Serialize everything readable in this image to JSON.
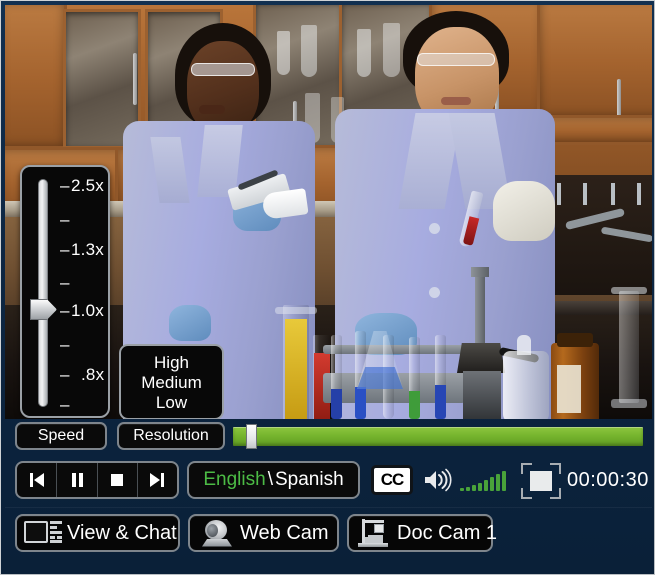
{
  "app": {
    "title": "Video Player — Chemistry Lab Session",
    "panel_color": "#0d2744",
    "accent_green": "#8dc63f",
    "language_active_color": "#4cbb45"
  },
  "video": {
    "scene_description": "Two students in lavender lab coats and safety goggles working at a chemistry bench with graduated cylinders, test tube rack, bunsen burner, amber reagent bottle and wash bottle; wooden glass-front cabinets behind.",
    "alt": "Chemistry laboratory video frame"
  },
  "speed_overlay": {
    "name": "Speed",
    "selected_value": "1.0x",
    "ticks": [
      {
        "label": "2.5x",
        "major": true
      },
      {
        "label": "",
        "major": false
      },
      {
        "label": "1.3x",
        "major": true
      },
      {
        "label": "",
        "major": false
      },
      {
        "label": "1.0x",
        "major": true
      },
      {
        "label": "",
        "major": false
      },
      {
        "label": ".8x",
        "major": true
      },
      {
        "label": "",
        "major": false
      }
    ]
  },
  "resolution_menu": {
    "options": [
      "High",
      "Medium",
      "Low"
    ]
  },
  "toolbar": {
    "speed_label": "Speed",
    "resolution_label": "Resolution",
    "progress": {
      "value_percent": 3,
      "buffered_percent": 100
    }
  },
  "transport": {
    "buttons": [
      {
        "name": "previous",
        "icon": "skip-back-icon",
        "label": "Previous"
      },
      {
        "name": "pause",
        "icon": "pause-icon",
        "label": "Pause"
      },
      {
        "name": "stop",
        "icon": "stop-icon",
        "label": "Stop"
      },
      {
        "name": "next",
        "icon": "skip-forward-icon",
        "label": "Next"
      }
    ]
  },
  "language": {
    "primary": "English",
    "separator": "\\",
    "secondary": "Spanish"
  },
  "captions": {
    "label": "CC",
    "enabled": true
  },
  "volume": {
    "icon": "speaker-icon",
    "level_bars": 8,
    "active_bars": 8
  },
  "fullscreen": {
    "icon": "fullscreen-icon",
    "label": "Fullscreen"
  },
  "time": {
    "display": "00:00:30"
  },
  "bottom_buttons": [
    {
      "label": "View & Chat",
      "icon": "view-chat-icon"
    },
    {
      "label": "Web Cam",
      "icon": "webcam-icon"
    },
    {
      "label": "Doc Cam 1",
      "icon": "doc-cam-icon"
    }
  ]
}
